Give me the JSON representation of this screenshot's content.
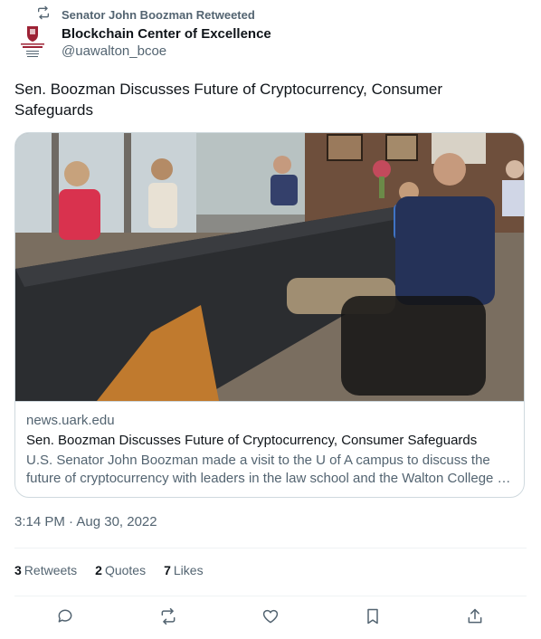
{
  "retweet_header": {
    "text": "Senator John Boozman Retweeted",
    "icon": "retweet-icon"
  },
  "author": {
    "display_name": "Blockchain Center of Excellence",
    "handle": "@uawalton_bcoe",
    "avatar_icon": "university-of-arkansas-logo",
    "brand_color": "#9d2235"
  },
  "tweet": {
    "text": "Sen. Boozman Discusses Future of Cryptocurrency, Consumer Safeguards"
  },
  "link_card": {
    "domain": "news.uark.edu",
    "title": "Sen. Boozman Discusses Future of Cryptocurrency, Consumer Safeguards",
    "description": "U.S. Senator John Boozman made a visit to the U of A campus to discuss the future of cryptocurrency with leaders in the law school and the Walton College of Business."
  },
  "timestamp": "3:14 PM · Aug 30, 2022",
  "stats": {
    "retweets_count": "3",
    "retweets_label": "Retweets",
    "quotes_count": "2",
    "quotes_label": "Quotes",
    "likes_count": "7",
    "likes_label": "Likes"
  },
  "actions": {
    "reply_icon": "reply-icon",
    "retweet_icon": "retweet-icon",
    "like_icon": "heart-icon",
    "bookmark_icon": "bookmark-icon",
    "share_icon": "share-icon"
  },
  "colors": {
    "text": "#0f1419",
    "secondary": "#536471",
    "border": "#cfd9de"
  }
}
